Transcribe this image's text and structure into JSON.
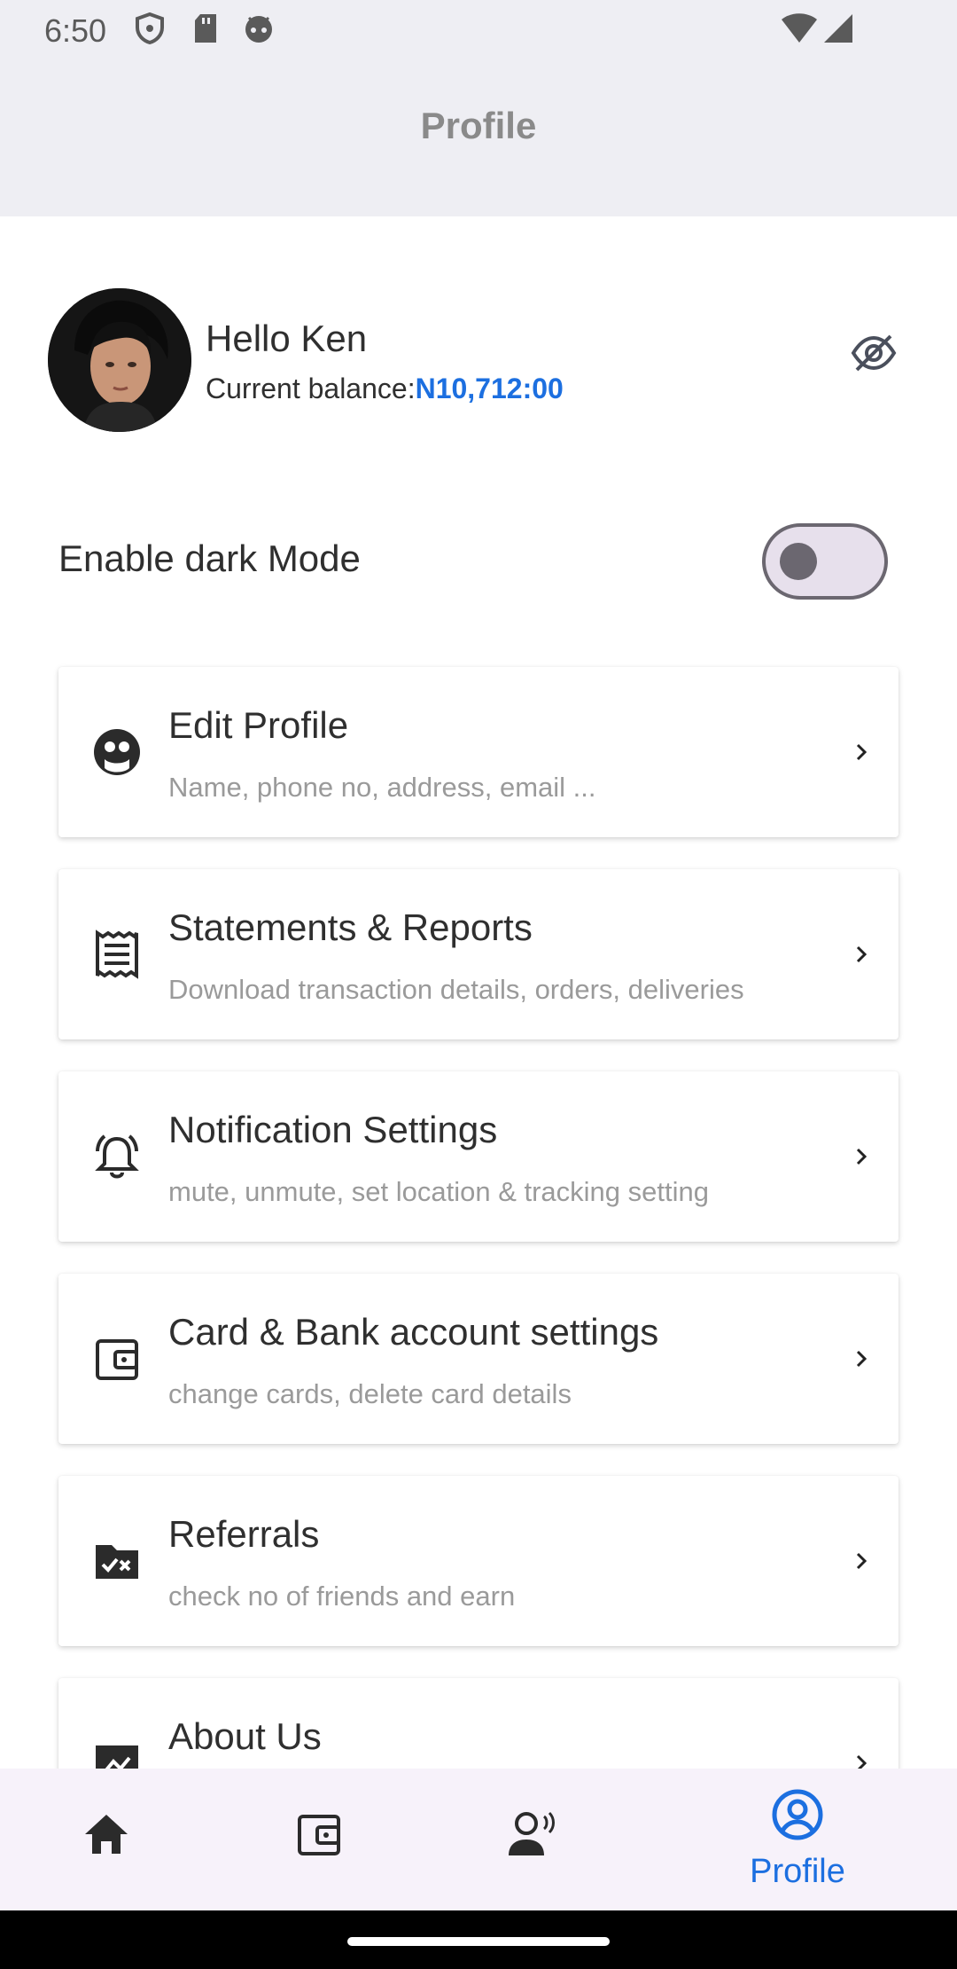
{
  "status_bar": {
    "time": "6:50"
  },
  "app_bar": {
    "title": "Profile"
  },
  "profile": {
    "greeting": "Hello Ken",
    "balance_label": "Current balance:",
    "balance_amount": "N10,712:00"
  },
  "dark_mode": {
    "label": "Enable dark Mode",
    "enabled": false
  },
  "menu": [
    {
      "title": "Edit Profile",
      "subtitle": "Name, phone no, address, email ...",
      "icon": "face-icon"
    },
    {
      "title": "Statements & Reports",
      "subtitle": "Download transaction details, orders, deliveries",
      "icon": "receipt-icon"
    },
    {
      "title": "Notification Settings",
      "subtitle": "mute, unmute, set location & tracking setting",
      "icon": "bell-icon"
    },
    {
      "title": "Card & Bank account settings",
      "subtitle": "change cards, delete card details",
      "icon": "wallet-icon"
    },
    {
      "title": "Referrals",
      "subtitle": "check no of friends and earn",
      "icon": "folder-referral-icon"
    },
    {
      "title": "About Us",
      "subtitle": "",
      "icon": "info-icon"
    }
  ],
  "bottom_nav": {
    "items": [
      {
        "name": "home",
        "icon": "home-icon",
        "label": ""
      },
      {
        "name": "wallet",
        "icon": "wallet-icon",
        "label": ""
      },
      {
        "name": "support",
        "icon": "support-agent-icon",
        "label": ""
      },
      {
        "name": "profile",
        "icon": "account-circle-icon",
        "label": "Profile",
        "active": true
      }
    ]
  },
  "colors": {
    "accent": "#1c6fe0",
    "appbar_bg": "#eeeef3",
    "nav_bg": "#f7f2fa"
  }
}
